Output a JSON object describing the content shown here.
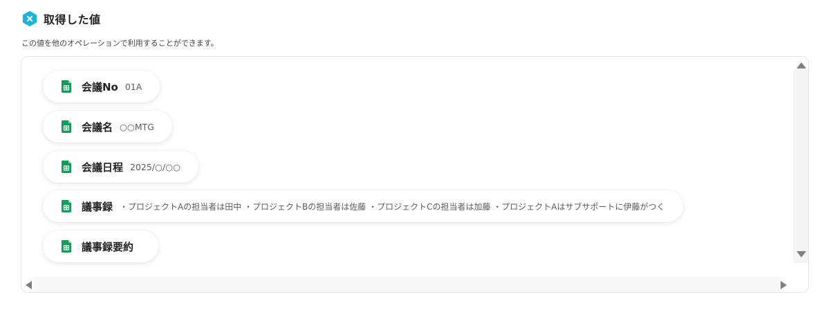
{
  "header": {
    "title": "取得した値",
    "description": "この値を他のオペレーションで利用することができます。",
    "icon": "close-hexagon-icon",
    "accent_color": "#1ab3d9"
  },
  "items": [
    {
      "label": "会議No",
      "value": "01A",
      "icon": "google-sheets-icon"
    },
    {
      "label": "会議名",
      "value": "○○MTG",
      "icon": "google-sheets-icon"
    },
    {
      "label": "会議日程",
      "value": "2025/○/○○",
      "icon": "google-sheets-icon"
    },
    {
      "label": "議事録",
      "value": "・プロジェクトAの担当者は田中 ・プロジェクトBの担当者は佐藤 ・プロジェクトCの担当者は加藤 ・プロジェクトAはサブサポートに伊藤がつく",
      "icon": "google-sheets-icon"
    },
    {
      "label": "議事録要約",
      "value": "",
      "icon": "google-sheets-icon"
    }
  ],
  "colors": {
    "sheets_green": "#0f9d58"
  }
}
